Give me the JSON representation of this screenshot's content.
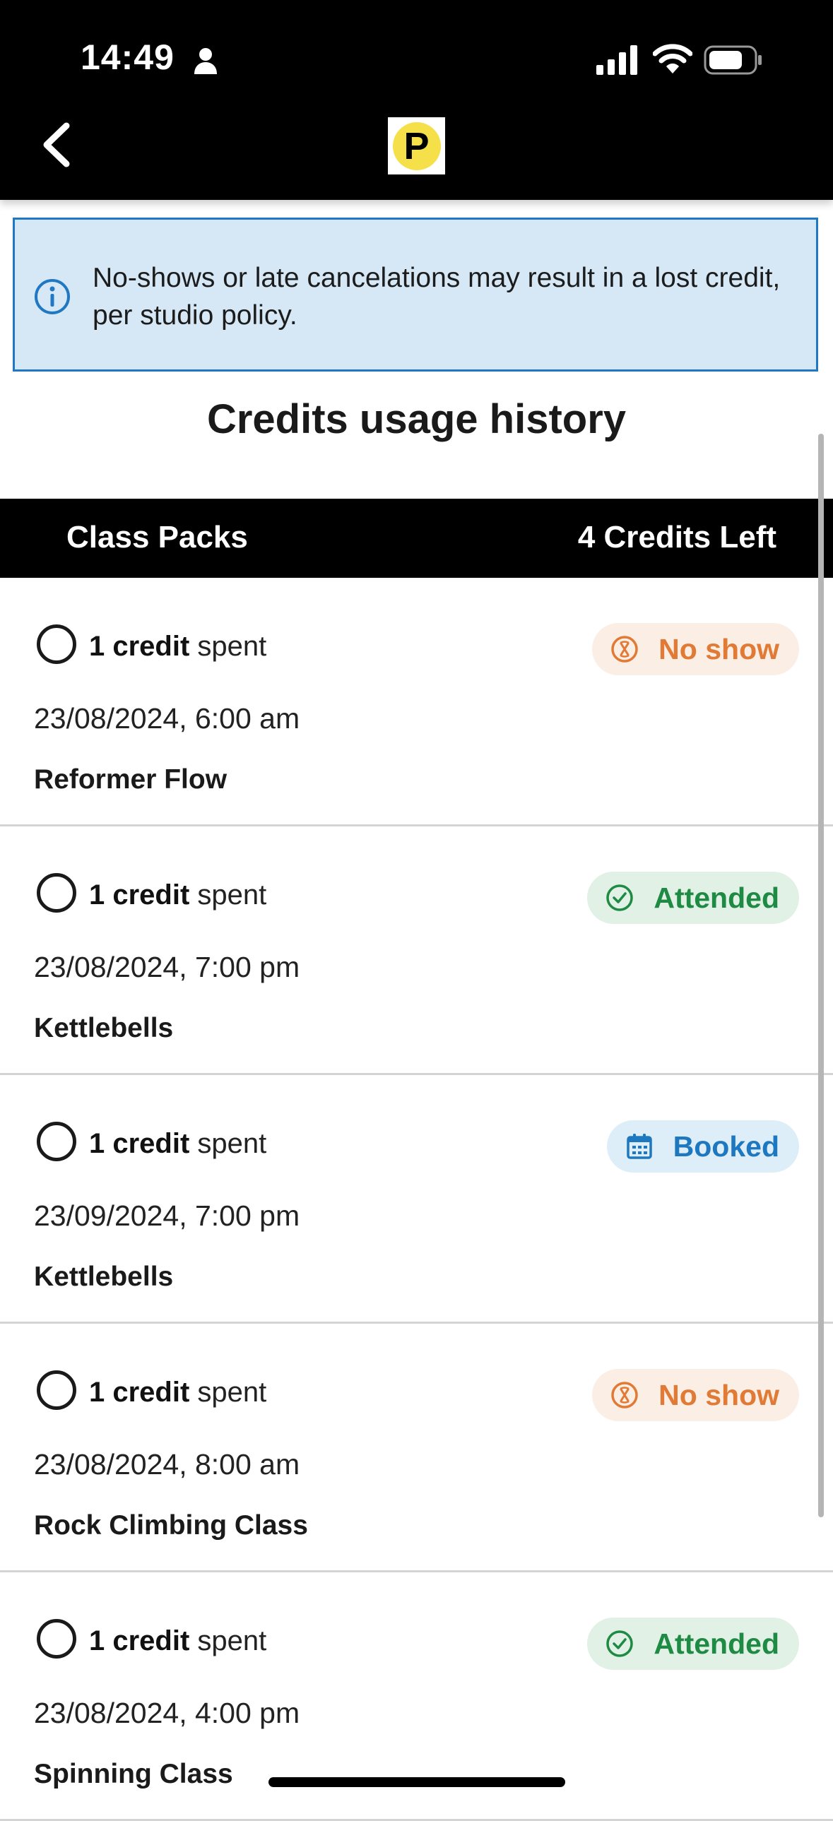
{
  "status_bar": {
    "time": "14:49"
  },
  "notice": {
    "text": "No-shows or late cancelations may result in a lost credit, per studio policy."
  },
  "heading": "Credits usage history",
  "pack_bar": {
    "left_label": "Class Packs",
    "right_label": "4 Credits Left"
  },
  "logo_letter": "P",
  "colors": {
    "noshow": "#e07a34",
    "attended": "#1f8a43",
    "booked": "#1d78c0",
    "notice_bg": "#d6e8f6",
    "notice_border": "#1f78c1"
  },
  "entries": [
    {
      "credit_bold": "1 credit",
      "credit_rest": " spent",
      "status": "No show",
      "status_type": "noshow",
      "datetime": "23/08/2024, 6:00 am",
      "class_name": "Reformer Flow"
    },
    {
      "credit_bold": "1 credit",
      "credit_rest": " spent",
      "status": "Attended",
      "status_type": "attended",
      "datetime": "23/08/2024, 7:00 pm",
      "class_name": "Kettlebells"
    },
    {
      "credit_bold": "1 credit",
      "credit_rest": " spent",
      "status": "Booked",
      "status_type": "booked",
      "datetime": "23/09/2024, 7:00 pm",
      "class_name": "Kettlebells"
    },
    {
      "credit_bold": "1 credit",
      "credit_rest": " spent",
      "status": "No show",
      "status_type": "noshow",
      "datetime": "23/08/2024, 8:00 am",
      "class_name": "Rock Climbing Class"
    },
    {
      "credit_bold": "1 credit",
      "credit_rest": " spent",
      "status": "Attended",
      "status_type": "attended",
      "datetime": "23/08/2024, 4:00 pm",
      "class_name": "Spinning Class"
    }
  ]
}
